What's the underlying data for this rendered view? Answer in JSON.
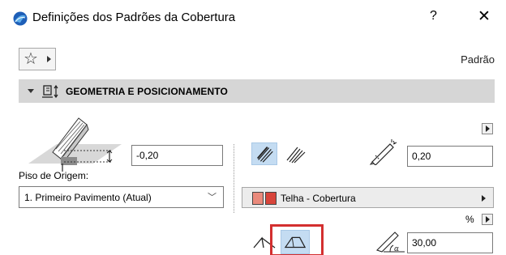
{
  "window": {
    "title": "Definições dos Padrões da Cobertura",
    "help_label": "?",
    "close_label": "✕",
    "icon": "archicad-app-icon"
  },
  "toolbar": {
    "favorites_icon": "star-icon",
    "favorites_label": "☆",
    "default_label": "Padrão"
  },
  "section": {
    "title": "GEOMETRIA E POSICIONAMENTO",
    "icon": "geometry-positioning-icon",
    "expanded": true
  },
  "geometry": {
    "offset_value": "-0,20",
    "floor_label": "Piso de Origem:",
    "floor_value": "1. Primeiro Pavimento (Atual)",
    "thickness_value": "0,20",
    "material_label": "Telha - Cobertura",
    "material_colors": [
      "#e88a7a",
      "#d9453c"
    ],
    "percent_label": "%",
    "slope_value": "30,00",
    "selected_hatch": 0,
    "selected_shape": 1
  },
  "colors": {
    "selected_bg": "#c4dcf2",
    "highlight": "#d32f2f",
    "section_bg": "#d6d6d6"
  }
}
